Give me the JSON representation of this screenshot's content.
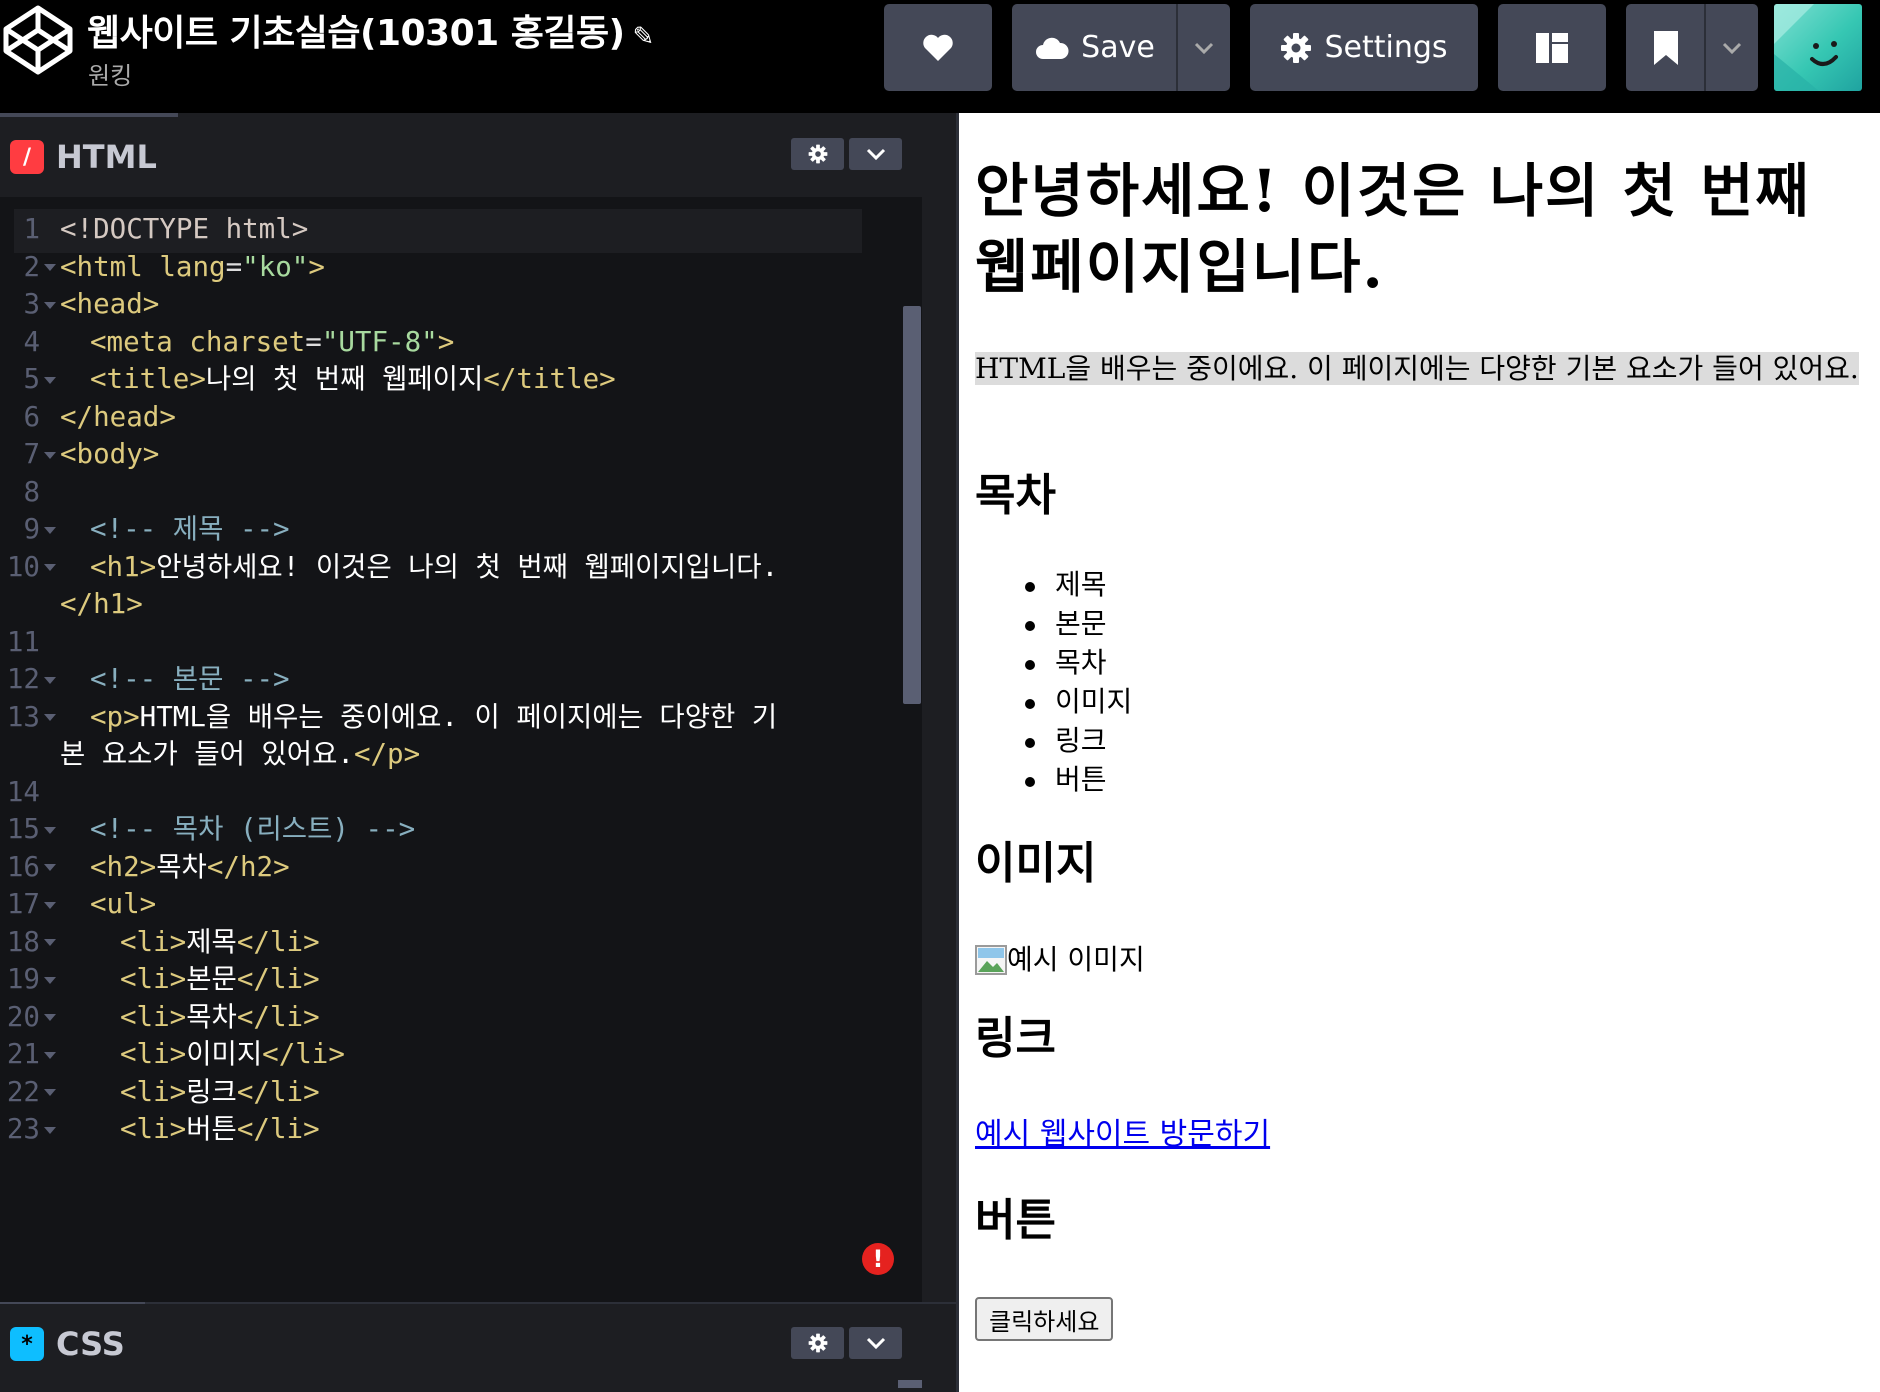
{
  "app": {
    "project_title": "웹사이트 기초실습(10301 홍길동)",
    "owner": "원킹"
  },
  "toolbar": {
    "save_label": "Save",
    "settings_label": "Settings"
  },
  "colors": {
    "topbar_bg": "#000000",
    "button_bg": "#444857",
    "editor_bg": "#1d1e22",
    "code_bg": "#131417",
    "html_badge": "#ff3c41",
    "css_badge": "#0ebeff",
    "error": "#e5221f",
    "link": "#0000ee"
  },
  "editors": {
    "html": {
      "badge": "/",
      "name": "HTML"
    },
    "css": {
      "badge": "*",
      "name": "CSS"
    }
  },
  "code": {
    "lines": [
      {
        "n": "1",
        "fold": false,
        "indent": 0,
        "parts": [
          [
            "doct",
            "<!DOCTYPE html>"
          ]
        ]
      },
      {
        "n": "2",
        "fold": true,
        "indent": 0,
        "parts": [
          [
            "tag",
            "<html "
          ],
          [
            "attr",
            "lang"
          ],
          [
            "eq",
            "="
          ],
          [
            "str",
            "\"ko\""
          ],
          [
            "tag",
            ">"
          ]
        ]
      },
      {
        "n": "3",
        "fold": true,
        "indent": 0,
        "parts": [
          [
            "tag",
            "<head>"
          ]
        ]
      },
      {
        "n": "4",
        "fold": false,
        "indent": 1,
        "parts": [
          [
            "tag",
            "<meta "
          ],
          [
            "attr",
            "charset"
          ],
          [
            "eq",
            "="
          ],
          [
            "str",
            "\"UTF-8\""
          ],
          [
            "tag",
            ">"
          ]
        ]
      },
      {
        "n": "5",
        "fold": true,
        "indent": 1,
        "parts": [
          [
            "tag",
            "<title>"
          ],
          [
            "txt",
            "나의 첫 번째 웹페이지"
          ],
          [
            "tag",
            "</title>"
          ]
        ]
      },
      {
        "n": "6",
        "fold": false,
        "indent": 0,
        "parts": [
          [
            "tag",
            "</head>"
          ]
        ]
      },
      {
        "n": "7",
        "fold": true,
        "indent": 0,
        "parts": [
          [
            "tag",
            "<body>"
          ]
        ]
      },
      {
        "n": "8",
        "fold": false,
        "indent": 0,
        "parts": []
      },
      {
        "n": "9",
        "fold": true,
        "indent": 1,
        "parts": [
          [
            "cmt",
            "<!-- 제목 -->"
          ]
        ]
      },
      {
        "n": "10",
        "fold": true,
        "indent": 1,
        "parts": [
          [
            "tag",
            "<h1>"
          ],
          [
            "txt",
            "안녕하세요! 이것은 나의 첫 번째 웹페이지입니다."
          ]
        ]
      },
      {
        "n": "",
        "fold": false,
        "indent": 0,
        "parts": [
          [
            "tag",
            "</h1>"
          ]
        ]
      },
      {
        "n": "11",
        "fold": false,
        "indent": 0,
        "parts": []
      },
      {
        "n": "12",
        "fold": true,
        "indent": 1,
        "parts": [
          [
            "cmt",
            "<!-- 본문 -->"
          ]
        ]
      },
      {
        "n": "13",
        "fold": true,
        "indent": 1,
        "parts": [
          [
            "tag",
            "<p>"
          ],
          [
            "txt",
            "HTML을 배우는 중이에요. 이 페이지에는 다양한 기"
          ]
        ]
      },
      {
        "n": "",
        "fold": false,
        "indent": 0,
        "parts": [
          [
            "txt",
            "본 요소가 들어 있어요."
          ],
          [
            "tag",
            "</p>"
          ]
        ]
      },
      {
        "n": "14",
        "fold": false,
        "indent": 0,
        "parts": []
      },
      {
        "n": "15",
        "fold": true,
        "indent": 1,
        "parts": [
          [
            "cmt",
            "<!-- 목차 (리스트) -->"
          ]
        ]
      },
      {
        "n": "16",
        "fold": true,
        "indent": 1,
        "parts": [
          [
            "tag",
            "<h2>"
          ],
          [
            "txt",
            "목차"
          ],
          [
            "tag",
            "</h2>"
          ]
        ]
      },
      {
        "n": "17",
        "fold": true,
        "indent": 1,
        "parts": [
          [
            "tag",
            "<ul>"
          ]
        ]
      },
      {
        "n": "18",
        "fold": true,
        "indent": 2,
        "parts": [
          [
            "tag",
            "<li>"
          ],
          [
            "txt",
            "제목"
          ],
          [
            "tag",
            "</li>"
          ]
        ]
      },
      {
        "n": "19",
        "fold": true,
        "indent": 2,
        "parts": [
          [
            "tag",
            "<li>"
          ],
          [
            "txt",
            "본문"
          ],
          [
            "tag",
            "</li>"
          ]
        ]
      },
      {
        "n": "20",
        "fold": true,
        "indent": 2,
        "parts": [
          [
            "tag",
            "<li>"
          ],
          [
            "txt",
            "목차"
          ],
          [
            "tag",
            "</li>"
          ]
        ]
      },
      {
        "n": "21",
        "fold": true,
        "indent": 2,
        "parts": [
          [
            "tag",
            "<li>"
          ],
          [
            "txt",
            "이미지"
          ],
          [
            "tag",
            "</li>"
          ]
        ]
      },
      {
        "n": "22",
        "fold": true,
        "indent": 2,
        "parts": [
          [
            "tag",
            "<li>"
          ],
          [
            "txt",
            "링크"
          ],
          [
            "tag",
            "</li>"
          ]
        ]
      },
      {
        "n": "23",
        "fold": true,
        "indent": 2,
        "parts": [
          [
            "tag",
            "<li>"
          ],
          [
            "txt",
            "버튼"
          ],
          [
            "tag",
            "</li>"
          ]
        ]
      }
    ],
    "error_badge": "!"
  },
  "preview": {
    "h1": "안녕하세요! 이것은 나의 첫 번째 웹페이지입니다.",
    "p": "HTML을 배우는 중이에요. 이 페이지에는 다양한 기본 요소가 들어 있어요.",
    "toc_heading": "목차",
    "toc_items": [
      "제목",
      "본문",
      "목차",
      "이미지",
      "링크",
      "버튼"
    ],
    "image_heading": "이미지",
    "image_alt": "예시 이미지",
    "link_heading": "링크",
    "link_text": "예시 웹사이트 방문하기",
    "button_heading": "버튼",
    "button_label": "클릭하세요"
  }
}
